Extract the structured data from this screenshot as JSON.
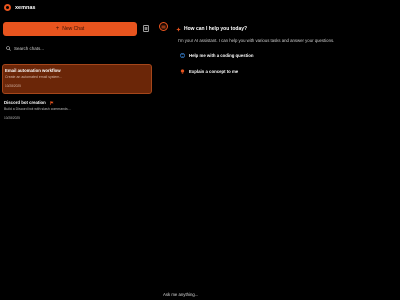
{
  "app": {
    "name": "xemnas"
  },
  "sidebar": {
    "new_chat_label": "New Chat",
    "search_placeholder": "Search chats...",
    "chats": [
      {
        "title": "Email automation workflow",
        "preview": "Create an automated email system...",
        "date": "10/28/2025",
        "active": true
      },
      {
        "title": "Discord bot creation",
        "preview": "Build a Discord bot with slash commands...",
        "date": "10/28/2025",
        "flagged": true
      }
    ]
  },
  "main": {
    "welcome_title": "How can I help you today?",
    "welcome_subtitle": "I'm your AI assistant. I can help you with various tasks and answer your questions.",
    "suggestions": [
      {
        "label": "Help me with a coding question",
        "icon": "code-icon"
      },
      {
        "label": "Explain a concept to me",
        "icon": "lightbulb-icon"
      }
    ],
    "composer_placeholder": "Ask me anything..."
  },
  "colors": {
    "accent": "#e8541e",
    "active_chat_bg": "#6b2608",
    "suggestion_icon_blue": "#3b8ee8",
    "background": "#000000"
  }
}
